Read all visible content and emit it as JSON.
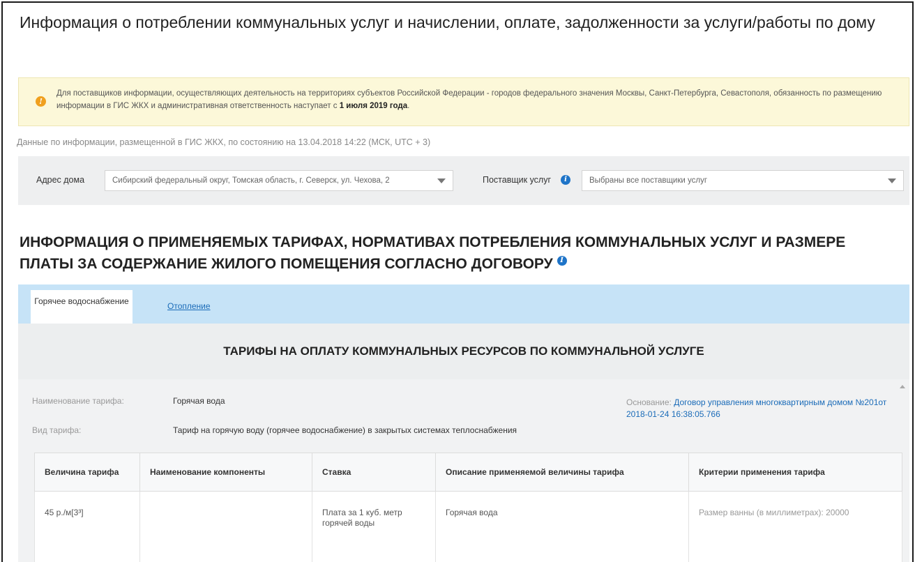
{
  "page": {
    "title": "Информация о потреблении коммунальных услуг и начислении, оплате, задолженности за услуги/работы по дому"
  },
  "notice": {
    "icon": "exclamation-icon",
    "text_before": "Для поставщиков информации, осуществляющих деятельность на территориях субъектов Российской Федерации - городов федерального значения Москвы, Санкт-Петербурга, Севастополя, обязанность по размещению информации в ГИС ЖКХ и административная ответственность наступает с ",
    "text_bold": "1 июля 2019 года",
    "text_after": "."
  },
  "status_line": "Данные по информации, размещенной в ГИС ЖКХ, по состоянию на 13.04.2018 14:22 (МСК, UTC + 3)",
  "filters": {
    "address_label": "Адрес дома",
    "address_value": "Сибирский федеральный округ, Томская область, г. Северск, ул. Чехова, 2",
    "provider_label": "Поставщик услуг",
    "provider_value": "Выбраны все поставщики услуг"
  },
  "section_title": "Информация о применяемых тарифах, нормативах потребления коммунальных услуг и размере платы за содержание жилого помещения согласно договору",
  "tabs": [
    {
      "label": "Горячее водоснабжение",
      "active": true
    },
    {
      "label": "Отопление",
      "active": false
    }
  ],
  "tariffs": {
    "header": "ТАРИФЫ НА ОПЛАТУ КОММУНАЛЬНЫХ РЕСУРСОВ ПО КОММУНАЛЬНОЙ УСЛУГЕ",
    "name_label": "Наименование тарифа:",
    "name_value": "Горячая вода",
    "basis_label": "Основание:",
    "basis_link": "Договор управления многоквартирным домом №201от 2018-01-24 16:38:05.766",
    "type_label": "Вид тарифа:",
    "type_value": "Тариф на горячую воду (горячее водоснабжение) в закрытых системах теплоснабжения",
    "columns": [
      "Величина тарифа",
      "Наименование компоненты",
      "Ставка",
      "Описание применяемой величины тарифа",
      "Критерии применения тарифа"
    ],
    "rows": [
      [
        "45 р./м[3³]",
        "",
        "Плата за 1 куб. метр горячей воды",
        "Горячая вода",
        "Размер ванны (в миллиметрах): 20000"
      ]
    ]
  },
  "colors": {
    "notice_bg": "#fcf8d9",
    "tabs_bg": "#c6e3f7",
    "link": "#1a6bb8",
    "info_icon": "#1e74c8",
    "warning_icon": "#f0a01e"
  }
}
